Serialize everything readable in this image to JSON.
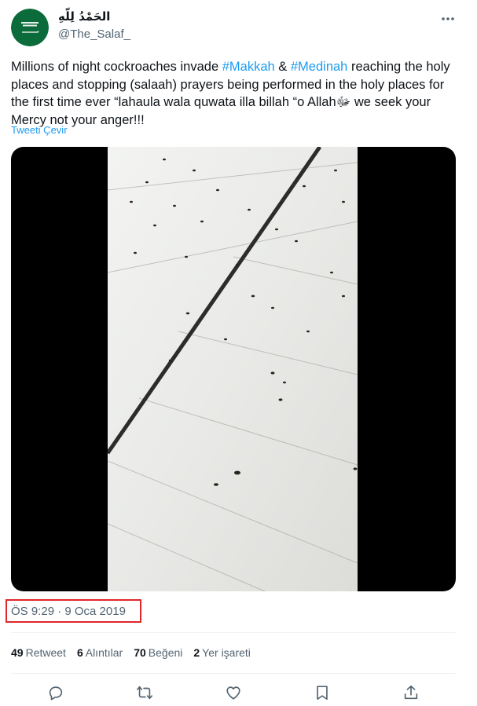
{
  "author": {
    "display_name": "الحَمْدُ لِلّهِ",
    "handle": "@The_Salaf_",
    "avatar_icon": "saudi-flag-icon"
  },
  "tweet": {
    "text_parts": {
      "p1": "Millions of night cockroaches invade ",
      "hashtag1": "#Makkah",
      "p2": " & ",
      "hashtag2": "#Medinah",
      "p3": " reaching the holy places and stopping (salaah) prayers being performed in the holy places for the first time ever “lahaula wala quwata illa billah “o Allahﷻ we seek your Mercy not your anger!!!"
    },
    "translate_label": "Tweeti Çevir",
    "timestamp": "ÖS 9:29 · 9 Oca 2019"
  },
  "stats": [
    {
      "count": "49",
      "label": "Retweet"
    },
    {
      "count": "6",
      "label": "Alıntılar"
    },
    {
      "count": "70",
      "label": "Beğeni"
    },
    {
      "count": "2",
      "label": "Yer işareti"
    }
  ],
  "actions": [
    "reply-icon",
    "retweet-icon",
    "like-icon",
    "bookmark-icon",
    "share-icon"
  ],
  "colors": {
    "link": "#1d9bf0",
    "muted": "#536471",
    "highlight_box": "#e0262b",
    "flag_green": "#0b6b3a"
  }
}
